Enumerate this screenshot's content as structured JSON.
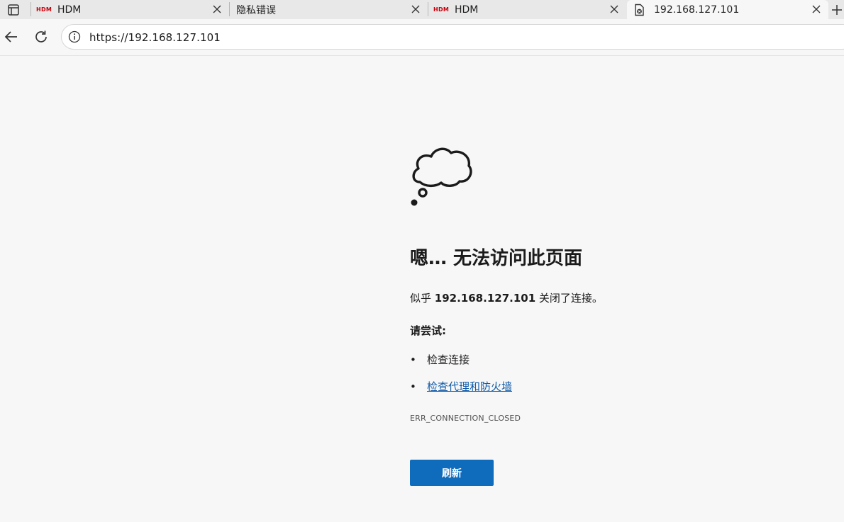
{
  "tabs": [
    {
      "favicon": "HDM",
      "title": "HDM",
      "active": false
    },
    {
      "favicon": "",
      "title": "隐私错误",
      "active": false
    },
    {
      "favicon": "HDM",
      "title": "HDM",
      "active": false
    },
    {
      "favicon": "error-page-icon",
      "title": "192.168.127.101",
      "active": true
    }
  ],
  "address_bar": {
    "url": "https://192.168.127.101"
  },
  "error": {
    "heading": "嗯… 无法访问此页面",
    "desc_prefix": "似乎",
    "desc_host": "192.168.127.101",
    "desc_suffix": "关闭了连接。",
    "try_label": "请尝试:",
    "suggestions": [
      {
        "text": "检查连接",
        "link": false
      },
      {
        "text": "检查代理和防火墙",
        "link": true
      }
    ],
    "code": "ERR_CONNECTION_CLOSED",
    "refresh_label": "刷新"
  },
  "colors": {
    "accent": "#0f6cbd",
    "link": "#0f5aa8",
    "brand_hdm": "#c7000b"
  }
}
